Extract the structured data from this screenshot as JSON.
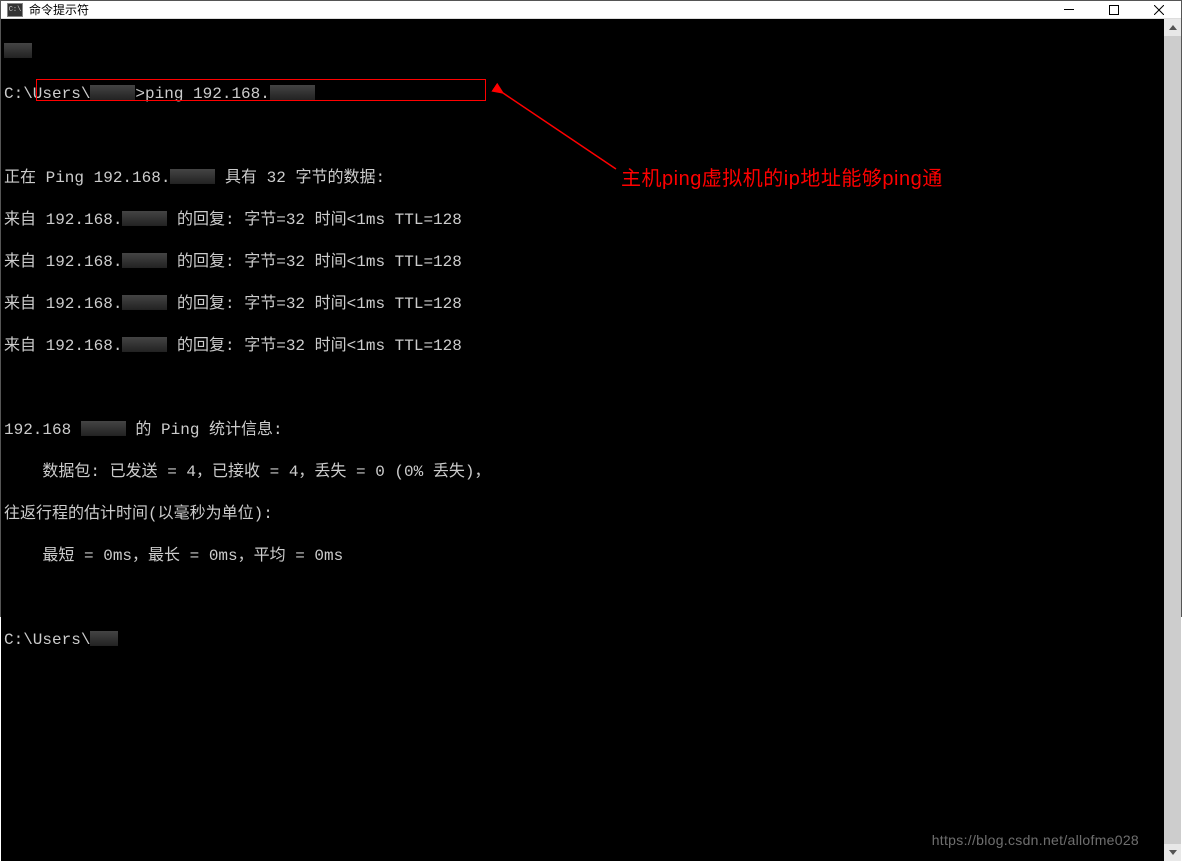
{
  "window": {
    "title": "命令提示符",
    "icon_label": "C:\\"
  },
  "terminal": {
    "lines": {
      "cmd1_prefix": "C:\\Users\\",
      "cmd1_suffix": ">ping 192.168.",
      "ping_header_a": "正在 Ping 192.168.",
      "ping_header_b": " 具有 32 字节的数据:",
      "reply_prefix": "来自 192.168.",
      "reply_suffix": " 的回复: 字节=32 时间<1ms TTL=128",
      "stats_header_a": "192.168",
      "stats_header_b": " 的 Ping 统计信息:",
      "stats_packets": "    数据包: 已发送 = 4，已接收 = 4，丢失 = 0 (0% 丢失)，",
      "stats_roundtrip": "往返行程的估计时间(以毫秒为单位):",
      "stats_times": "    最短 = 0ms，最长 = 0ms，平均 = 0ms",
      "prompt2": "C:\\Users\\"
    }
  },
  "annotation": {
    "text": "主机ping虚拟机的ip地址能够ping通"
  },
  "watermark": {
    "text": "https://blog.csdn.net/allofme028"
  }
}
